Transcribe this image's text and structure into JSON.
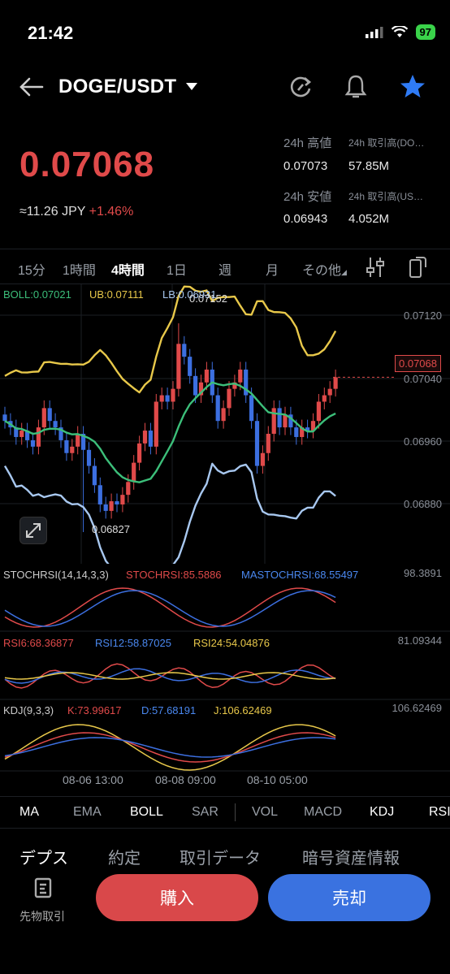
{
  "status": {
    "time": "21:42",
    "battery": "97"
  },
  "header": {
    "pair": "DOGE/USDT"
  },
  "ticker": {
    "price": "0.07068",
    "jpy": "≈11.26 JPY",
    "change": "+1.46%",
    "high_label": "24h 高値",
    "high_value": "0.07073",
    "low_label": "24h 安値",
    "low_value": "0.06943",
    "vol_base_label": "24h 取引高(DO…",
    "vol_base_value": "57.85M",
    "vol_quote_label": "24h 取引高(US…",
    "vol_quote_value": "4.052M"
  },
  "timeframes": [
    "15分",
    "1時間",
    "4時間",
    "1日",
    "週",
    "月",
    "その他"
  ],
  "active_timeframe": "4時間",
  "chart": {
    "boll_label": "BOLL:0.07021",
    "ub_label": "UB:0.07111",
    "lb_label": "LB:0.06931",
    "axis": [
      "0.07120",
      "0.07040",
      "0.06960",
      "0.06880"
    ],
    "current_price": "0.07068",
    "max_label": "0.07152",
    "min_label": "0.06827",
    "x_ticks": [
      "08-06 13:00",
      "08-08 09:00",
      "08-10 05:00"
    ],
    "colors": {
      "up": "#e04a4a",
      "down": "#3c6fe0",
      "mid": "#3cbf7a",
      "ub": "#e8c84a",
      "lb": "#a8c8f0"
    }
  },
  "stochrsi": {
    "title": "STOCHRSI(14,14,3,3)",
    "k": "STOCHRSI:85.5886",
    "d": "MASTOCHRSI:68.55497",
    "axis": "98.3891"
  },
  "rsi": {
    "rsi6": "RSI6:68.36877",
    "rsi12": "RSI12:58.87025",
    "rsi24": "RSI24:54.04876",
    "axis": "81.09344"
  },
  "kdj": {
    "title": "KDJ(9,3,3)",
    "k": "K:73.99617",
    "d": "D:57.68191",
    "j": "J:106.62469",
    "axis": "106.62469"
  },
  "indicator_tabs": [
    "MA",
    "EMA",
    "BOLL",
    "SAR",
    "VOL",
    "MACD",
    "KDJ",
    "RSI"
  ],
  "active_indicators": [
    "BOLL",
    "KDJ"
  ],
  "section_tabs": [
    "デプス",
    "約定",
    "取引データ",
    "暗号資産情報"
  ],
  "futures_label": "先物取引",
  "buy_label": "購入",
  "sell_label": "売却"
}
